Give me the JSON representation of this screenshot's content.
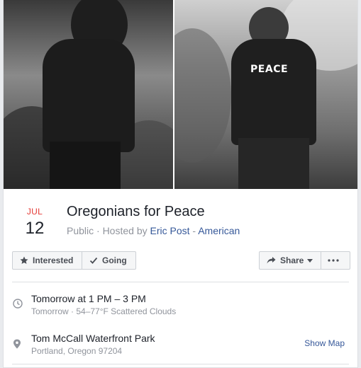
{
  "event": {
    "month": "JUL",
    "day": "12",
    "title": "Oregonians for Peace",
    "visibility_prefix": "Public · Hosted by ",
    "host_name": "Eric Post",
    "host_separator": " - ",
    "host_org": "American"
  },
  "cover": {
    "shirt_text": "PEACE"
  },
  "actions": {
    "interested_label": "Interested",
    "going_label": "Going",
    "share_label": "Share"
  },
  "details": {
    "time_primary": "Tomorrow at 1 PM – 3 PM",
    "time_secondary": "Tomorrow · 54–77°F Scattered Clouds",
    "location_primary": "Tom McCall Waterfront Park",
    "location_secondary": "Portland, Oregon 97204",
    "show_map_label": "Show Map"
  },
  "colors": {
    "link": "#365899",
    "month": "#e53935",
    "text": "#1d2129",
    "muted": "#90949c"
  }
}
